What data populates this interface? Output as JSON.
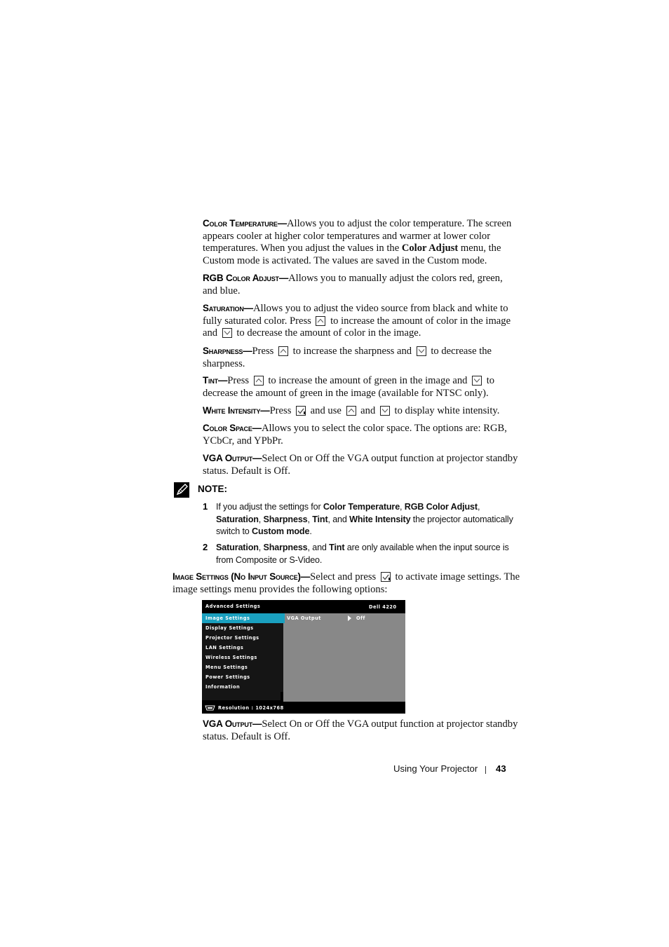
{
  "sections": [
    {
      "heading": "Color Temperature",
      "dash": "—",
      "body_1": "Allows you to adjust the color temperature. The screen appears cooler at higher color temperatures and warmer at lower color temperatures. When you adjust the values in the ",
      "bold_1": "Color Adjust",
      "body_2": " menu, the Custom mode is activated. The values are saved in the Custom mode."
    },
    {
      "heading": "RGB Color Adjust",
      "dash": "—",
      "body_1": "Allows you to manually adjust the colors red, green, and blue."
    },
    {
      "heading": "Saturation",
      "dash": "—",
      "body_1": "Allows you to adjust the video source from black and white to fully saturated color. Press ",
      "body_2": " to increase the amount of color in the image and ",
      "body_3": " to decrease the amount of color in the image."
    },
    {
      "heading": "Sharpness",
      "dash": "—",
      "body_1": "Press ",
      "body_2": " to increase the sharpness and ",
      "body_3": " to decrease the sharpness."
    },
    {
      "heading": "Tint",
      "dash": "—",
      "body_1": "Press ",
      "body_2": " to increase the amount of green in the image and ",
      "body_3": " to decrease the amount of green in the image (available for NTSC only)."
    },
    {
      "heading": "White Intensity",
      "dash": "—",
      "body_1": "Press ",
      "body_2": " and use ",
      "body_3": " and ",
      "body_4": " to display white intensity."
    },
    {
      "heading": "Color Space",
      "dash": "—",
      "body_1": "Allows you to select the color space. The options are: RGB, YCbCr, and YPbPr."
    },
    {
      "heading": "VGA Output",
      "dash": "—",
      "body_1": "Select On or Off the VGA output function at projector standby status. Default is Off."
    }
  ],
  "note": {
    "label": "NOTE:",
    "items": [
      {
        "num": "1",
        "t1": "If you adjust the settings for ",
        "b1": "Color Temperature",
        "t2": ", ",
        "b2": "RGB Color Adjust",
        "t3": ", ",
        "b3": "Saturation",
        "t4": ", ",
        "b4": "Sharpness",
        "t5": ", ",
        "b5": "Tint",
        "t6": ", and ",
        "b6": "White Intensity",
        "t7": " the projector automatically switch to ",
        "b7": "Custom mode",
        "t8": "."
      },
      {
        "num": "2",
        "b1": "Saturation",
        "t1": ", ",
        "b2": "Sharpness",
        "t2": ", and ",
        "b3": "Tint",
        "t3": " are only available when the input source is from Composite or S-Video."
      }
    ]
  },
  "image_settings": {
    "heading": "Image Settings (No Input Source)",
    "dash": "—",
    "body_1": "Select and press ",
    "body_2": " to activate image settings. The image settings menu provides the following options:"
  },
  "osd": {
    "title": "Advanced Settings",
    "brand": "Dell 4220",
    "menu_items": [
      {
        "label": "Image Settings",
        "selected": true
      },
      {
        "label": "Display Settings",
        "selected": false
      },
      {
        "label": "Projector Settings",
        "selected": false
      },
      {
        "label": "LAN Settings",
        "selected": false
      },
      {
        "label": "Wireless Settings",
        "selected": false
      },
      {
        "label": "Menu Settings",
        "selected": false
      },
      {
        "label": "Power Settings",
        "selected": false
      },
      {
        "label": "Information",
        "selected": false
      }
    ],
    "option_label": "VGA Output",
    "option_value": "Off",
    "resolution": "Resolution : 1024x768",
    "colors": {
      "highlight": "#1aa0bf",
      "panel": "#888888",
      "background": "#000000"
    }
  },
  "vga_output_repeat": {
    "heading": "VGA Output",
    "dash": "—",
    "body_1": "Select On or Off the VGA output function at projector standby status. Default is Off."
  },
  "footer": {
    "title": "Using Your Projector",
    "page_number": "43"
  }
}
